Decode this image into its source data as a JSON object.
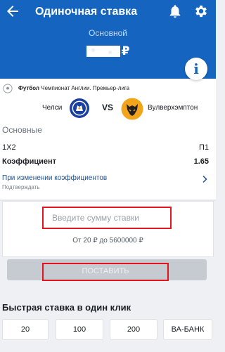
{
  "header": {
    "title": "Одиночная ставка",
    "subtitle": "Основной",
    "balance_currency": "₽",
    "bg_color": "#1565c0"
  },
  "icons": [
    "back-arrow-icon",
    "bell-icon",
    "gear-icon",
    "info-icon",
    "soccer-ball-icon",
    "chevron-right-icon"
  ],
  "event": {
    "sport": "Футбол",
    "league": "Чемпионат Англии. Премьер-лига",
    "team_home": "Челси",
    "vs": "VS",
    "team_away": "Вулверхэмптон"
  },
  "bet": {
    "section_title": "Основные",
    "market": "1X2",
    "outcome": "П1",
    "coef_label": "Коэффициент",
    "coef_value": "1.65",
    "odds_change_label": "При изменении коэффициентов",
    "odds_change_value": "Подтверждать"
  },
  "stake": {
    "placeholder": "Введите сумму ставки",
    "value": "",
    "range_text": "От 20 ₽ до 5600000 ₽",
    "place_label": "ПОСТАВИТЬ"
  },
  "quick_bet": {
    "title": "Быстрая ставка в один клик",
    "amounts": [
      "20",
      "100",
      "200",
      "ВА-БАНК"
    ]
  },
  "colors": {
    "highlight": "#e4141c",
    "link": "#1c4e8f"
  }
}
